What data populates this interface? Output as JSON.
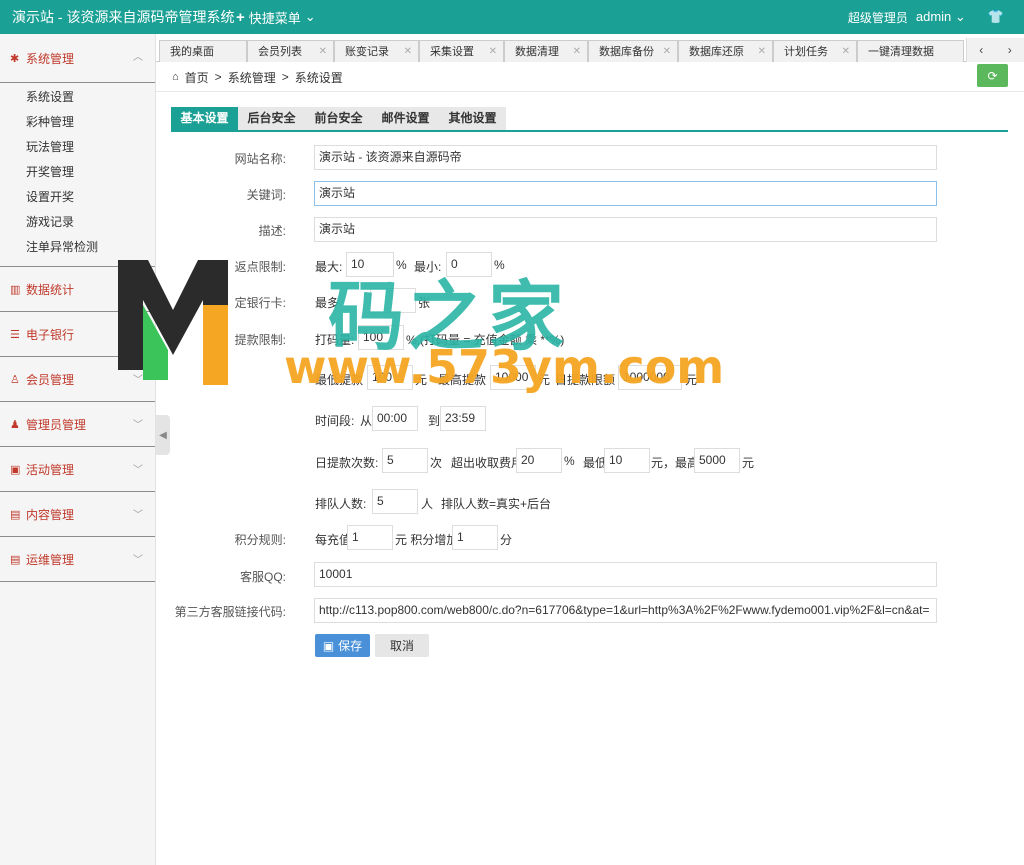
{
  "topbar": {
    "brand": "演示站 - 该资源来自源码帝管理系统",
    "quick_menu": "快捷菜单",
    "role": "超级管理员",
    "user": "admin"
  },
  "sidebar": {
    "groups": [
      {
        "label": "系统管理",
        "icon": "gear-icon",
        "items": [
          "系统设置",
          "彩种管理",
          "玩法管理",
          "开奖管理",
          "设置开奖",
          "游戏记录",
          "注单异常检测"
        ]
      },
      {
        "label": "数据统计",
        "icon": "bar-chart-icon"
      },
      {
        "label": "电子银行",
        "icon": "list-icon"
      },
      {
        "label": "会员管理",
        "icon": "user-icon"
      },
      {
        "label": "管理员管理",
        "icon": "admin-icon"
      },
      {
        "label": "活动管理",
        "icon": "gift-icon"
      },
      {
        "label": "内容管理",
        "icon": "book-icon"
      },
      {
        "label": "运维管理",
        "icon": "book-icon"
      }
    ]
  },
  "tabs": [
    "我的桌面",
    "会员列表",
    "账变记录",
    "采集设置",
    "数据清理",
    "数据库备份",
    "数据库还原",
    "计划任务",
    "一键清理数据"
  ],
  "breadcrumb": [
    "首页",
    "系统管理",
    "系统设置"
  ],
  "settings_tabs": [
    "基本设置",
    "后台安全",
    "前台安全",
    "邮件设置",
    "其他设置"
  ],
  "form": {
    "site_name_label": "网站名称:",
    "site_name": "演示站 - 该资源来自源码帝",
    "keywords_label": "关键词:",
    "keywords": "演示站",
    "desc_label": "描述:",
    "desc": "演示站",
    "rebate_label": "返点限制:",
    "rebate_max_label": "最大:",
    "rebate_max": "10",
    "rebate_min_label": "最小:",
    "rebate_min": "0",
    "percent": "%",
    "bind_card_label": "定银行卡:",
    "bind_card_prefix": "最多",
    "bind_card": "",
    "bind_card_unit": "张",
    "withdraw_label": "提款限制:",
    "bet_amount_label": "打码量:",
    "bet_amount": "100",
    "bet_amount_note": "%,(打码量 = 充值金额 乘 **%)",
    "min_withdraw_label": "最低提款",
    "min_withdraw": "100",
    "yuan": "元",
    "max_withdraw_label": "最高提款",
    "max_withdraw": "10000",
    "daily_limit_label": "日提款限额",
    "daily_limit": "1000000",
    "time_label": "时间段:",
    "from_label": "从",
    "time_from": "00:00",
    "to_label": "到",
    "time_to": "23:59",
    "daily_count_label": "日提款次数:",
    "daily_count": "5",
    "times_unit": "次",
    "fee_label": "超出收取费用",
    "fee": "20",
    "fee_min_label": "最低",
    "fee_min": "10",
    "fee_max_label": "元，最高",
    "fee_max": "5000",
    "queue_label": "排队人数:",
    "queue": "5",
    "queue_unit": "人",
    "queue_note": "排队人数=真实+后台",
    "points_label": "积分规则:",
    "points_prefix": "每充值",
    "points_recharge": "1",
    "points_mid": "元 积分增加",
    "points_add": "1",
    "points_unit": "分",
    "qq_label": "客服QQ:",
    "qq": "10001",
    "third_label": "第三方客服链接代码:",
    "third": "http://c113.pop800.com/web800/c.do?n=617706&type=1&url=http%3A%2F%2Fwww.fydemo001.vip%2F&l=cn&at="
  },
  "buttons": {
    "save": "保存",
    "cancel": "取消"
  },
  "watermark": {
    "text": "码之家",
    "url": "www.573ym.com"
  },
  "colors": {
    "primary": "#1aa094",
    "save": "#4a90d9",
    "refresh": "#5cb85c"
  }
}
